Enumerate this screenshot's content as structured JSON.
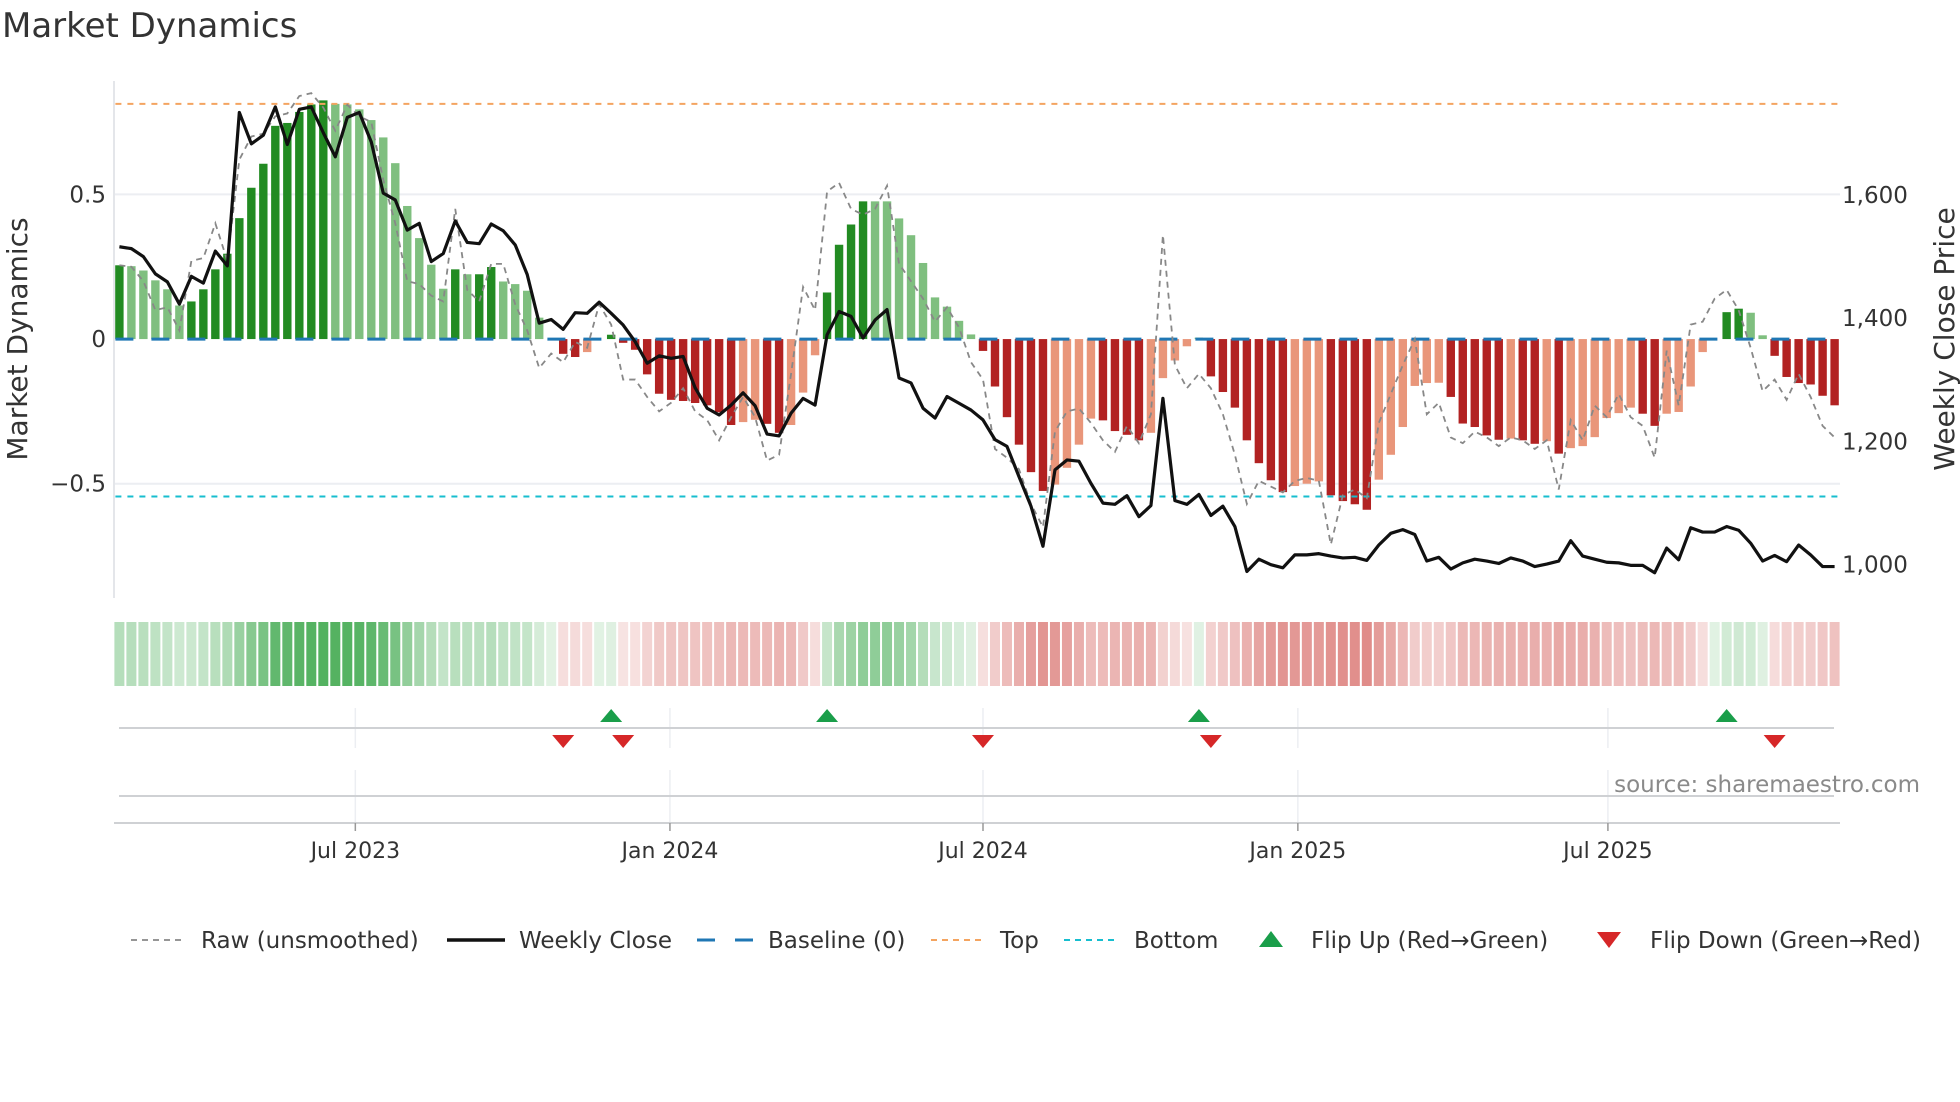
{
  "chart_data": {
    "type": "bar",
    "title": "Market Dynamics",
    "ylabel": "Market Dynamics",
    "ylabel_right": "Weekly Close Price",
    "xlim": [
      0.55,
      144.45
    ],
    "ylim": [
      -0.895,
      0.892
    ],
    "ylim_right": [
      946,
      1785
    ],
    "yticks": [
      {
        "v": 0.5,
        "label": "0.5"
      },
      {
        "v": 0,
        "label": "0"
      },
      {
        "v": -0.5,
        "label": "−0.5"
      }
    ],
    "yticks_right": [
      {
        "v": 1600,
        "label": "1,600"
      },
      {
        "v": 1400,
        "label": "1,400"
      },
      {
        "v": 1200,
        "label": "1,200"
      },
      {
        "v": 1000,
        "label": "1,000"
      }
    ],
    "xticks": [
      {
        "week": 20.67,
        "label": "Jul 2023"
      },
      {
        "week": 46.9,
        "label": "Jan 2024"
      },
      {
        "week": 73.0,
        "label": "Jul 2024"
      },
      {
        "week": 99.25,
        "label": "Jan 2025"
      },
      {
        "week": 125.1,
        "label": "Jul 2025"
      }
    ],
    "top_level": 0.813,
    "bottom_level": -0.544,
    "baseline": 0,
    "grid": true,
    "legend_position": "bottom",
    "source": "source: sharemaestro.com",
    "colors": {
      "green_strong": "#228b22",
      "green_weak": "#7fbf7f",
      "red_strong": "#b22222",
      "red_weak": "#e9967a",
      "top": "#f4a460",
      "bottom": "#17becf",
      "baseline": "#1f77b4",
      "close": "#111111",
      "raw": "#888888",
      "flip_up": "#1a9e4a",
      "flip_down": "#d62728",
      "heat_green": "44,160,60",
      "heat_red": "205,70,65"
    },
    "series": [
      {
        "name": "Market Dynamics (smoothed)",
        "axis": "left",
        "values": [
          0.255,
          0.252,
          0.237,
          0.203,
          0.172,
          0.116,
          0.13,
          0.172,
          0.241,
          0.295,
          0.418,
          0.523,
          0.606,
          0.737,
          0.747,
          0.785,
          0.811,
          0.825,
          0.813,
          0.811,
          0.794,
          0.757,
          0.697,
          0.608,
          0.46,
          0.349,
          0.257,
          0.174,
          0.241,
          0.224,
          0.224,
          0.249,
          0.199,
          0.19,
          0.167,
          0.074,
          0,
          -0.051,
          -0.062,
          -0.045,
          0,
          0.015,
          -0.013,
          -0.037,
          -0.122,
          -0.189,
          -0.21,
          -0.214,
          -0.221,
          -0.229,
          -0.253,
          -0.297,
          -0.287,
          -0.279,
          -0.293,
          -0.324,
          -0.297,
          -0.185,
          -0.056,
          0.161,
          0.326,
          0.396,
          0.476,
          0.476,
          0.476,
          0.417,
          0.359,
          0.263,
          0.144,
          0.112,
          0.063,
          0.016,
          -0.041,
          -0.164,
          -0.27,
          -0.365,
          -0.46,
          -0.525,
          -0.503,
          -0.445,
          -0.365,
          -0.275,
          -0.281,
          -0.318,
          -0.331,
          -0.35,
          -0.324,
          -0.135,
          -0.074,
          -0.025,
          0.005,
          -0.129,
          -0.183,
          -0.237,
          -0.35,
          -0.429,
          -0.488,
          -0.529,
          -0.508,
          -0.5,
          -0.492,
          -0.54,
          -0.56,
          -0.571,
          -0.59,
          -0.486,
          -0.4,
          -0.304,
          -0.162,
          -0.152,
          -0.151,
          -0.2,
          -0.292,
          -0.304,
          -0.333,
          -0.348,
          -0.344,
          -0.35,
          -0.362,
          -0.353,
          -0.396,
          -0.377,
          -0.37,
          -0.339,
          -0.273,
          -0.256,
          -0.237,
          -0.258,
          -0.3,
          -0.258,
          -0.252,
          -0.164,
          -0.045,
          0,
          0.093,
          0.105,
          0.091,
          0.013,
          -0.058,
          -0.131,
          -0.152,
          -0.157,
          -0.196,
          -0.229
        ],
        "shades": "DLLLLLDDDDDDDDDDDDLLLLLLLLLLDLDDLLLLLDDLLDDDDDDDDDDDLLDDLLLDDDDLLLLLLLLLDDDDDDLLLLDDDDLLLLLDDDDDDDLLLDDDDLLLLLLDDDDDLDDLDLLLLLLDDLLLLLDDLLDDDDDD"
      },
      {
        "name": "Raw (unsmoothed)",
        "axis": "left",
        "values": [
          0.255,
          0.25,
          0.2,
          0.1,
          0.11,
          0.03,
          0.27,
          0.28,
          0.4,
          0.27,
          0.62,
          0.7,
          0.71,
          0.77,
          0.78,
          0.84,
          0.85,
          0.8,
          0.72,
          0.81,
          0.77,
          0.75,
          0.55,
          0.4,
          0.2,
          0.19,
          0.15,
          0.13,
          0.45,
          0.17,
          0.13,
          0.26,
          0.26,
          0.12,
          0.03,
          -0.1,
          -0.05,
          -0.08,
          -0.01,
          -0.03,
          0.12,
          0.05,
          -0.14,
          -0.14,
          -0.2,
          -0.25,
          -0.22,
          -0.17,
          -0.25,
          -0.28,
          -0.35,
          -0.27,
          -0.2,
          -0.27,
          -0.42,
          -0.4,
          -0.12,
          0.18,
          0.1,
          0.51,
          0.54,
          0.45,
          0.43,
          0.45,
          0.53,
          0.26,
          0.2,
          0.14,
          0.06,
          0.11,
          0.04,
          -0.08,
          -0.14,
          -0.38,
          -0.41,
          -0.45,
          -0.57,
          -0.65,
          -0.32,
          -0.25,
          -0.24,
          -0.29,
          -0.35,
          -0.39,
          -0.3,
          -0.36,
          -0.26,
          0.36,
          -0.09,
          -0.17,
          -0.12,
          -0.17,
          -0.26,
          -0.4,
          -0.57,
          -0.49,
          -0.51,
          -0.53,
          -0.49,
          -0.48,
          -0.49,
          -0.71,
          -0.54,
          -0.52,
          -0.55,
          -0.29,
          -0.19,
          -0.09,
          0,
          -0.26,
          -0.22,
          -0.34,
          -0.36,
          -0.32,
          -0.34,
          -0.37,
          -0.34,
          -0.35,
          -0.38,
          -0.35,
          -0.52,
          -0.28,
          -0.35,
          -0.23,
          -0.27,
          -0.19,
          -0.27,
          -0.3,
          -0.41,
          -0.04,
          -0.23,
          0.05,
          0.06,
          0.14,
          0.17,
          0.1,
          -0.03,
          -0.18,
          -0.14,
          -0.21,
          -0.12,
          -0.2,
          -0.3,
          -0.34
        ]
      },
      {
        "name": "Weekly Close",
        "axis": "right",
        "values": [
          1516,
          1513,
          1500,
          1472,
          1459,
          1423,
          1468,
          1457,
          1509,
          1485,
          1734,
          1683,
          1697,
          1743,
          1682,
          1739,
          1743,
          1701,
          1662,
          1726,
          1734,
          1686,
          1603,
          1592,
          1543,
          1554,
          1492,
          1505,
          1558,
          1523,
          1521,
          1553,
          1542,
          1519,
          1471,
          1392,
          1398,
          1382,
          1409,
          1408,
          1426,
          1408,
          1389,
          1362,
          1327,
          1339,
          1335,
          1338,
          1287,
          1254,
          1243,
          1259,
          1279,
          1258,
          1212,
          1209,
          1246,
          1270,
          1259,
          1373,
          1411,
          1403,
          1368,
          1397,
          1414,
          1303,
          1295,
          1254,
          1238,
          1273,
          1262,
          1251,
          1235,
          1203,
          1192,
          1143,
          1095,
          1030,
          1154,
          1170,
          1168,
          1132,
          1100,
          1098,
          1112,
          1078,
          1096,
          1270,
          1104,
          1098,
          1114,
          1080,
          1095,
          1062,
          989,
          1009,
          1000,
          995,
          1016,
          1016,
          1018,
          1014,
          1011,
          1012,
          1007,
          1032,
          1051,
          1057,
          1049,
          1006,
          1012,
          993,
          1003,
          1009,
          1006,
          1002,
          1011,
          1006,
          997,
          1001,
          1006,
          1039,
          1014,
          1009,
          1004,
          1003,
          999,
          999,
          987,
          1027,
          1008,
          1060,
          1053,
          1053,
          1062,
          1056,
          1035,
          1006,
          1015,
          1005,
          1032,
          1016,
          997,
          997
        ]
      }
    ],
    "flips_up_weeks": [
      42,
      60,
      91,
      135
    ],
    "flips_down_weeks": [
      38,
      43,
      73,
      92,
      139
    ],
    "legend": [
      {
        "key": "raw",
        "label": "Raw (unsmoothed)"
      },
      {
        "key": "close",
        "label": "Weekly Close"
      },
      {
        "key": "baseline",
        "label": "Baseline (0)"
      },
      {
        "key": "top",
        "label": "Top"
      },
      {
        "key": "bottom",
        "label": "Bottom"
      },
      {
        "key": "flip_up",
        "label": "Flip Up (Red→Green)"
      },
      {
        "key": "flip_down",
        "label": "Flip Down (Green→Red)"
      }
    ]
  }
}
